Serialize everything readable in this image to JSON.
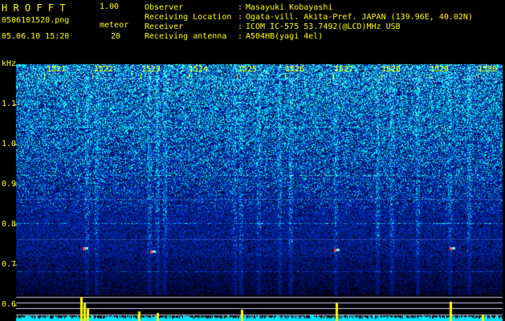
{
  "app": {
    "name": "H R O F F T",
    "version": "1.00",
    "filename": "0506101520.png",
    "datetime": "05.06.10 15:20",
    "meteor_label": "meteor",
    "meteor_count": "20"
  },
  "info": {
    "rows": [
      {
        "label": "Observer",
        "sep": ":",
        "value": "Masayuki Kobayashi"
      },
      {
        "label": "Receiving Location",
        "sep": ":",
        "value": "Ogata-vill. Akita-Pref. JAPAN (139.96E, 40.02N)"
      },
      {
        "label": "Receiver",
        "sep": ":",
        "value": "ICOM IC-575 53.7492(@LCD)MHz USB"
      },
      {
        "label": "Receiving antenna",
        "sep": ":",
        "value": "A504HB(yagi 4el)"
      }
    ]
  },
  "spectrogram": {
    "y_unit": "kHz",
    "y_ticks": [
      "1.1",
      "1.0",
      "0.9",
      "0.8",
      "0.7",
      "0.6"
    ],
    "x_ticks": [
      "1521",
      "1522",
      "1523",
      "1524",
      "1525",
      "1526",
      "1527",
      "1528",
      "1529",
      "1530"
    ],
    "colors": {
      "background": "#000000",
      "noise": "#0a2ab8",
      "signal": "#00e5ff",
      "meteor": "#ffff00",
      "text": "#ffff00"
    }
  }
}
